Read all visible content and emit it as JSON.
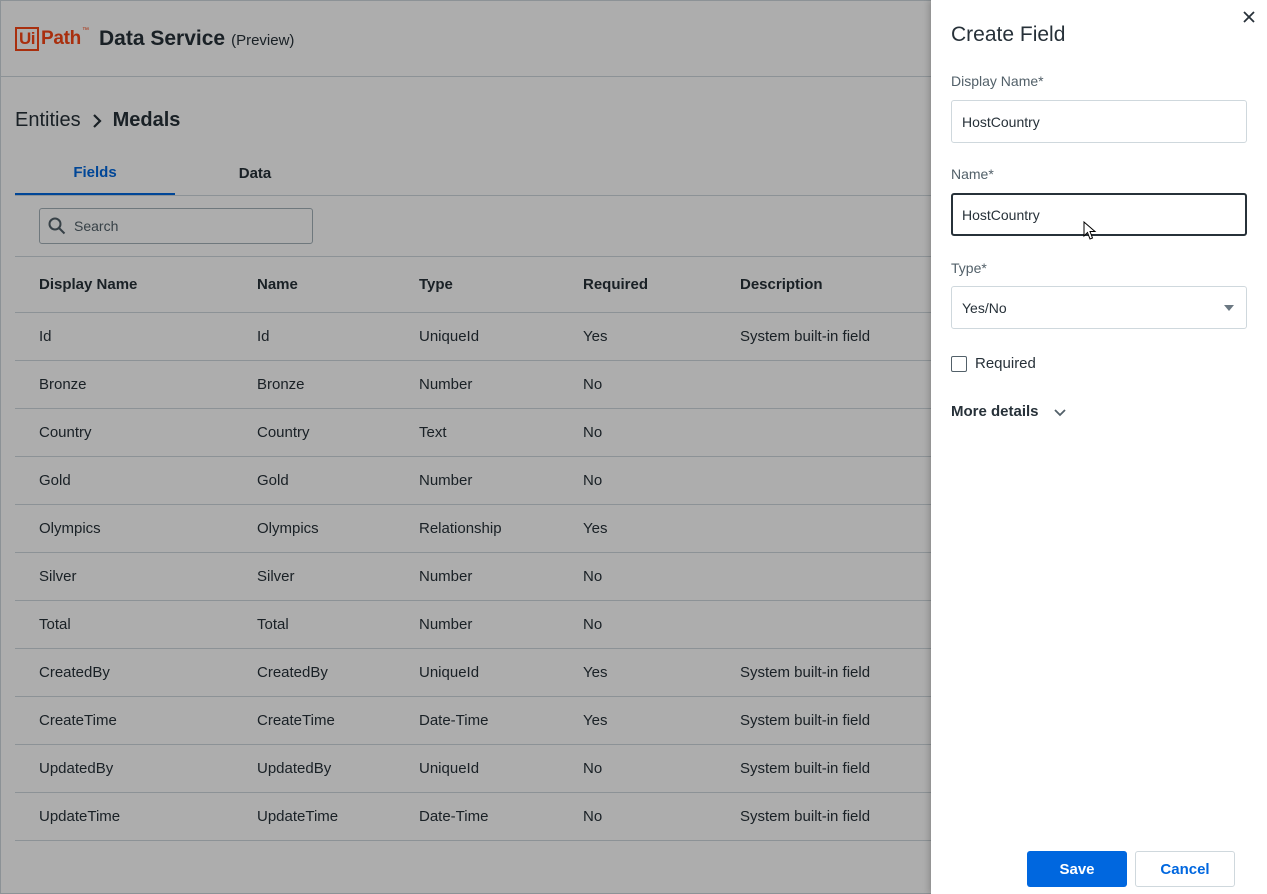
{
  "header": {
    "logo_ui": "Ui",
    "logo_path": "Path",
    "logo_tm": "™",
    "title": "Data Service",
    "subtitle": "(Preview)"
  },
  "breadcrumb": {
    "parent": "Entities",
    "current": "Medals"
  },
  "tabs": [
    {
      "label": "Fields",
      "active": true
    },
    {
      "label": "Data",
      "active": false
    }
  ],
  "search": {
    "placeholder": "Search",
    "value": ""
  },
  "table": {
    "columns": [
      "Display Name",
      "Name",
      "Type",
      "Required",
      "Description"
    ],
    "rows": [
      [
        "Id",
        "Id",
        "UniqueId",
        "Yes",
        "System built-in field"
      ],
      [
        "Bronze",
        "Bronze",
        "Number",
        "No",
        ""
      ],
      [
        "Country",
        "Country",
        "Text",
        "No",
        ""
      ],
      [
        "Gold",
        "Gold",
        "Number",
        "No",
        ""
      ],
      [
        "Olympics",
        "Olympics",
        "Relationship",
        "Yes",
        ""
      ],
      [
        "Silver",
        "Silver",
        "Number",
        "No",
        ""
      ],
      [
        "Total",
        "Total",
        "Number",
        "No",
        ""
      ],
      [
        "CreatedBy",
        "CreatedBy",
        "UniqueId",
        "Yes",
        "System built-in field"
      ],
      [
        "CreateTime",
        "CreateTime",
        "Date-Time",
        "Yes",
        "System built-in field"
      ],
      [
        "UpdatedBy",
        "UpdatedBy",
        "UniqueId",
        "No",
        "System built-in field"
      ],
      [
        "UpdateTime",
        "UpdateTime",
        "Date-Time",
        "No",
        "System built-in field"
      ]
    ]
  },
  "panel": {
    "title": "Create Field",
    "display_name_label": "Display Name*",
    "display_name_value": "HostCountry",
    "name_label": "Name*",
    "name_value": "HostCountry",
    "type_label": "Type*",
    "type_value": "Yes/No",
    "required_label": "Required",
    "required_checked": false,
    "more_details_label": "More details",
    "save_label": "Save",
    "cancel_label": "Cancel"
  },
  "colors": {
    "brand": "#fa4616",
    "accent": "#0067df",
    "text": "#273139"
  }
}
